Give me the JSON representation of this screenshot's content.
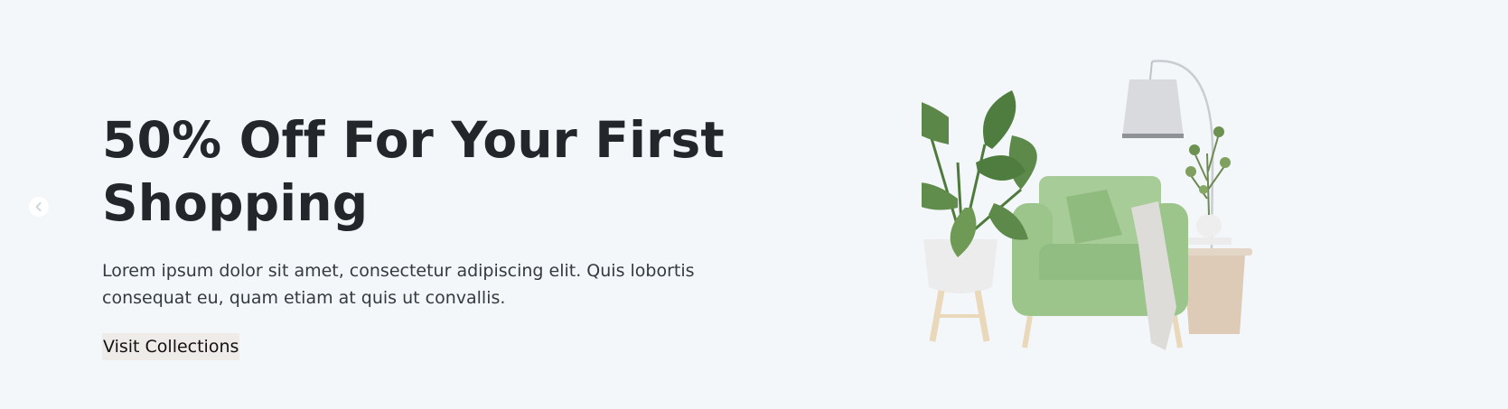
{
  "hero": {
    "title": "50% Off For Your First Shopping",
    "description": "Lorem ipsum dolor sit amet, consectetur adipiscing elit. Quis lobortis consequat eu, quam etiam at quis ut convallis.",
    "cta_label": "Visit Collections",
    "prev_icon": "chevron-left-icon"
  },
  "colors": {
    "background": "#f4f7fa",
    "text": "#23272b",
    "button_bg": "#eeebe8",
    "chair_green": "#9cc58c",
    "plant_green": "#5d8a4a"
  }
}
